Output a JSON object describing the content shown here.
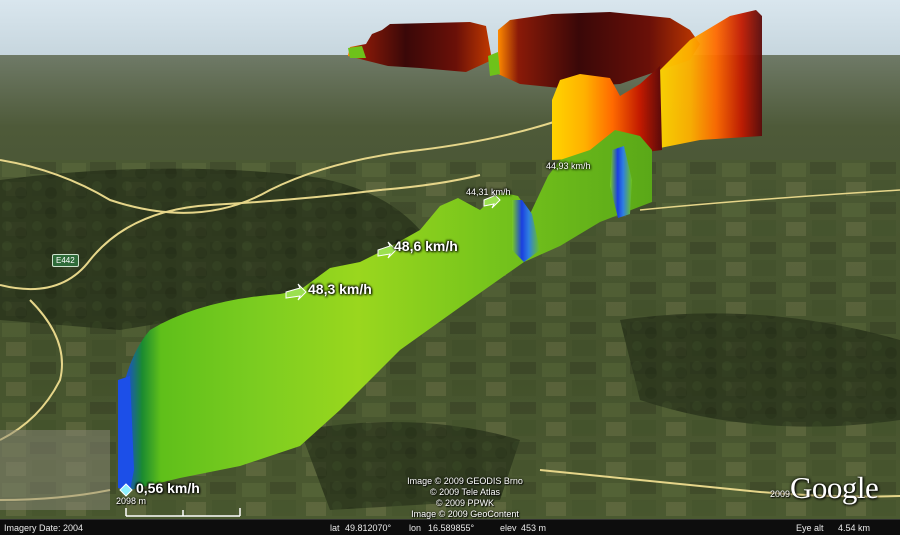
{
  "speed_labels": {
    "start": "0,56 km/h",
    "label_1": "48,3 km/h",
    "label_2": "48,6 km/h",
    "label_3": "44,31 km/h",
    "label_4": "44,93 km/h"
  },
  "scale": {
    "left_value": "2098 m",
    "right_value": "2009"
  },
  "road_shield": "E442",
  "credits": [
    "Image © 2009 GEODIS Brno",
    "© 2009 Tele Atlas",
    "© 2009 PPWK",
    "Image © 2009 GeoContent"
  ],
  "logo": "Google",
  "status": {
    "imagery_date": "Imagery Date: 2004",
    "lat_label": "lat",
    "lat_value": "49.812070°",
    "lon_label": "lon",
    "lon_value": "16.589855°",
    "elev_label": "elev",
    "elev_value": "453 m",
    "eye_alt_label": "Eye alt",
    "eye_alt_value": "4.54 km"
  },
  "colors": {
    "sky": "#dfe8ee",
    "terrain": "#3e4a2a",
    "low_speed": "#1f3fe0",
    "mid_speed": "#6ec21a",
    "high_speed": "#e6a000",
    "top_speed": "#3a0a0a"
  }
}
